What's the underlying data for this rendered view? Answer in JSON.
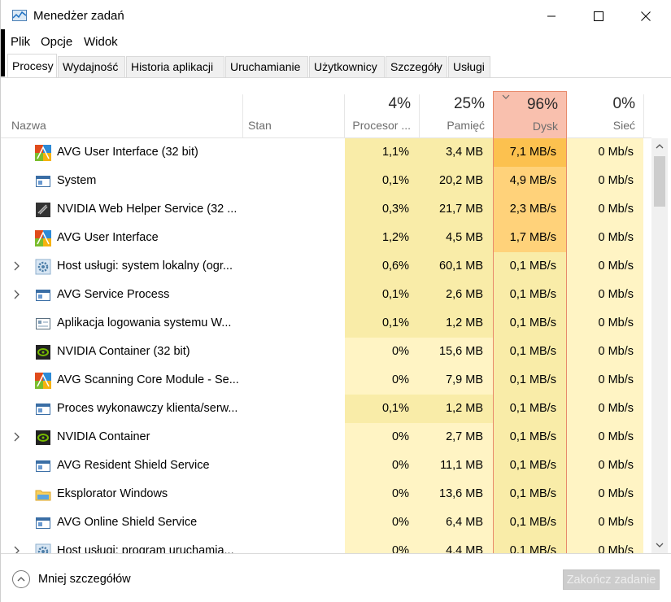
{
  "window": {
    "title": "Menedżer zadań"
  },
  "menu": [
    "Plik",
    "Opcje",
    "Widok"
  ],
  "tabs": [
    "Procesy",
    "Wydajność",
    "Historia aplikacji",
    "Uruchamianie",
    "Użytkownicy",
    "Szczegóły",
    "Usługi"
  ],
  "header": {
    "name": "Nazwa",
    "status": "Stan",
    "cpu_pct": "4%",
    "cpu_label": "Procesor ...",
    "mem_pct": "25%",
    "mem_label": "Pamięć",
    "disk_pct": "96%",
    "disk_label": "Dysk",
    "net_pct": "0%",
    "net_label": "Sieć"
  },
  "processes": [
    {
      "name": "AVG User Interface (32 bit)",
      "cpu": "1,1%",
      "mem": "3,4 MB",
      "disk": "7,1 MB/s",
      "net": "0 Mb/s",
      "icon": "avg-icon",
      "expand": false
    },
    {
      "name": "System",
      "cpu": "0,1%",
      "mem": "20,2 MB",
      "disk": "4,9 MB/s",
      "net": "0 Mb/s",
      "icon": "app-window-icon",
      "expand": false
    },
    {
      "name": "NVIDIA Web Helper Service (32 ...",
      "cpu": "0,3%",
      "mem": "21,7 MB",
      "disk": "2,3 MB/s",
      "net": "0 Mb/s",
      "icon": "nvidia-web-icon",
      "expand": false
    },
    {
      "name": "AVG User Interface",
      "cpu": "1,2%",
      "mem": "4,5 MB",
      "disk": "1,7 MB/s",
      "net": "0 Mb/s",
      "icon": "avg-icon",
      "expand": false
    },
    {
      "name": "Host usługi: system lokalny (ogr...",
      "cpu": "0,6%",
      "mem": "60,1 MB",
      "disk": "0,1 MB/s",
      "net": "0 Mb/s",
      "icon": "gear-icon",
      "expand": true
    },
    {
      "name": "AVG Service Process",
      "cpu": "0,1%",
      "mem": "2,6 MB",
      "disk": "0,1 MB/s",
      "net": "0 Mb/s",
      "icon": "app-window-icon",
      "expand": true
    },
    {
      "name": "Aplikacja logowania systemu W...",
      "cpu": "0,1%",
      "mem": "1,2 MB",
      "disk": "0,1 MB/s",
      "net": "0 Mb/s",
      "icon": "logon-icon",
      "expand": false
    },
    {
      "name": "NVIDIA Container (32 bit)",
      "cpu": "0%",
      "mem": "15,6 MB",
      "disk": "0,1 MB/s",
      "net": "0 Mb/s",
      "icon": "nvidia-icon",
      "expand": false
    },
    {
      "name": "AVG Scanning Core Module - Se...",
      "cpu": "0%",
      "mem": "7,9 MB",
      "disk": "0,1 MB/s",
      "net": "0 Mb/s",
      "icon": "avg-icon",
      "expand": false
    },
    {
      "name": "Proces wykonawczy klienta/serw...",
      "cpu": "0,1%",
      "mem": "1,2 MB",
      "disk": "0,1 MB/s",
      "net": "0 Mb/s",
      "icon": "app-window-icon",
      "expand": false
    },
    {
      "name": "NVIDIA Container",
      "cpu": "0%",
      "mem": "2,7 MB",
      "disk": "0,1 MB/s",
      "net": "0 Mb/s",
      "icon": "nvidia-icon",
      "expand": true
    },
    {
      "name": "AVG Resident Shield Service",
      "cpu": "0%",
      "mem": "11,1 MB",
      "disk": "0,1 MB/s",
      "net": "0 Mb/s",
      "icon": "app-window-icon",
      "expand": false
    },
    {
      "name": "Eksplorator Windows",
      "cpu": "0%",
      "mem": "13,6 MB",
      "disk": "0,1 MB/s",
      "net": "0 Mb/s",
      "icon": "folder-icon",
      "expand": false
    },
    {
      "name": "AVG Online Shield Service",
      "cpu": "0%",
      "mem": "6,4 MB",
      "disk": "0,1 MB/s",
      "net": "0 Mb/s",
      "icon": "app-window-icon",
      "expand": false
    },
    {
      "name": "Host usługi: program uruchamia...",
      "cpu": "0%",
      "mem": "4,4 MB",
      "disk": "0,1 MB/s",
      "net": "0 Mb/s",
      "icon": "gear-icon",
      "expand": true
    }
  ],
  "footer": {
    "fewer_details": "Mniej szczegółów",
    "end_task": "Zakończ zadanie"
  },
  "colors": {
    "heat_light": "#fff4c4",
    "heat_mid": "#f9eca8",
    "disk_high": "#ffd27a",
    "disk_top": "#fcc14f",
    "disk_header": "#f9c0ae"
  }
}
